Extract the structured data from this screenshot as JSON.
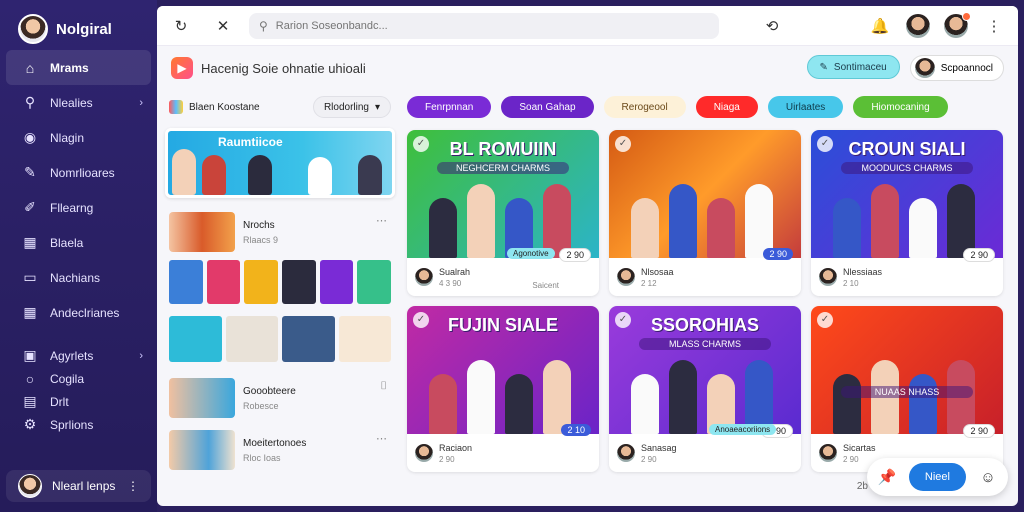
{
  "app": {
    "name": "Nolgiral"
  },
  "sidebar": {
    "items": [
      {
        "label": "Mrams",
        "icon": "home-icon",
        "active": true,
        "chevron": false
      },
      {
        "label": "Nlealies",
        "icon": "search-icon",
        "active": false,
        "chevron": true
      },
      {
        "label": "Nlagin",
        "icon": "avatar-icon",
        "active": false,
        "chevron": false
      },
      {
        "label": "Nomrlioares",
        "icon": "pencil-icon",
        "active": false,
        "chevron": false
      },
      {
        "label": "Fllearng",
        "icon": "edit-icon",
        "active": false,
        "chevron": false
      },
      {
        "label": "Blaela",
        "icon": "grid-icon",
        "active": false,
        "chevron": false
      },
      {
        "label": "Nachians",
        "icon": "chat-icon",
        "active": false,
        "chevron": false
      },
      {
        "label": "Andeclrianes",
        "icon": "grid-icon",
        "active": false,
        "chevron": false
      }
    ],
    "items2": [
      {
        "label": "Agyrlets",
        "icon": "bookmark-icon",
        "chevron": true
      },
      {
        "label": "Cogila",
        "icon": "circle-icon",
        "chevron": false
      },
      {
        "label": "Drlt",
        "icon": "document-icon",
        "chevron": false
      },
      {
        "label": "Sprlions",
        "icon": "settings-icon",
        "chevron": false
      }
    ],
    "profile_label": "Nlearl lenps"
  },
  "topbar": {
    "search_placeholder": "Rarion Soseonbandc...",
    "icons": [
      "refresh-icon",
      "close-icon",
      "history-icon",
      "notifications-icon",
      "user-avatar",
      "user-avatar-alert",
      "more-icon"
    ]
  },
  "header": {
    "title": "Hacenig Soie ohnatie uhioali",
    "btn_teal": "Sontimaceu",
    "btn_white": "Scpoannocl"
  },
  "left": {
    "heading": "Blaen Koostane",
    "select_label": "Rlodorling",
    "banner_title": "Raumtiicoe",
    "items": [
      {
        "title": "Nrochs",
        "sub": "Rlaacs 9"
      },
      {
        "title": "Gooobteere",
        "sub": "Robesce"
      },
      {
        "title": "Moeitertonoes",
        "sub": "Rloc Ioas"
      }
    ]
  },
  "chips": [
    {
      "label": "Fenrpnnan",
      "bg": "#7a2bd6",
      "fg": "#ffffff"
    },
    {
      "label": "Soan Gahap",
      "bg": "#6b25c8",
      "fg": "#ffffff"
    },
    {
      "label": "Rerogeool",
      "bg": "#fdf1d8",
      "fg": "#6b4a1a"
    },
    {
      "label": "Niaga",
      "bg": "#ff2a2a",
      "fg": "#ffffff"
    },
    {
      "label": "Uirlaates",
      "bg": "#47c7ea",
      "fg": "#0f3b4c"
    },
    {
      "label": "Hiomocaning",
      "bg": "#5bbf36",
      "fg": "#ffffff"
    }
  ],
  "cards": [
    {
      "title": "BL ROMUIIN",
      "sub": "NEGHCERM CHARMS",
      "name": "Sualrah",
      "count": "4 3 90",
      "badge": "2 90",
      "tag": "Agonotive",
      "foot": "Saicent",
      "bg": "linear-gradient(135deg,#3fbf3a,#2cb4c8)",
      "footbg": "#ffffff",
      "blue": false
    },
    {
      "title": "",
      "sub": "",
      "name": "Nlsosaa",
      "count": "2 12",
      "badge": "2 90",
      "tag": "",
      "foot": "",
      "bg": "linear-gradient(135deg,#d45a14,#ff9b2a 50%,#c43c3c)",
      "footbg": "#ffffff",
      "blue": true
    },
    {
      "title": "CROUN SIALI",
      "sub": "MOODUICS CHARMS",
      "name": "Nlessiaas",
      "count": "2 10",
      "badge": "2 90",
      "tag": "",
      "foot": "",
      "bg": "linear-gradient(135deg,#2a4fd8,#6b2ad6)",
      "footbg": "#ffffff",
      "blue": false
    },
    {
      "title": "FUJIN SIALE",
      "sub": "",
      "name": "Raciaon",
      "count": "2 90",
      "badge": "2 10",
      "tag": "",
      "foot": "",
      "bg": "linear-gradient(135deg,#c12aa4,#6a24c8)",
      "footbg": "#ffffff",
      "blue": true
    },
    {
      "title": "SSOROHIAS",
      "sub": "MLASS CHARMS",
      "name": "Sanasag",
      "count": "2 90",
      "badge": "2 90",
      "tag": "Anoaeacoriions",
      "foot": "",
      "bg": "linear-gradient(135deg,#9a3bdb,#5a2bd0)",
      "footbg": "#ffffff",
      "blue": false
    },
    {
      "title": "",
      "sub": "NUAAS NHASS",
      "name": "Sicartas",
      "count": "2 90",
      "badge": "2 90",
      "tag": "",
      "foot": "",
      "bg": "linear-gradient(135deg,#ff4a1a,#c7202a)",
      "footbg": "#ffffff",
      "blue": false
    }
  ],
  "fab": {
    "primary": "Nieel",
    "side": "2b"
  }
}
